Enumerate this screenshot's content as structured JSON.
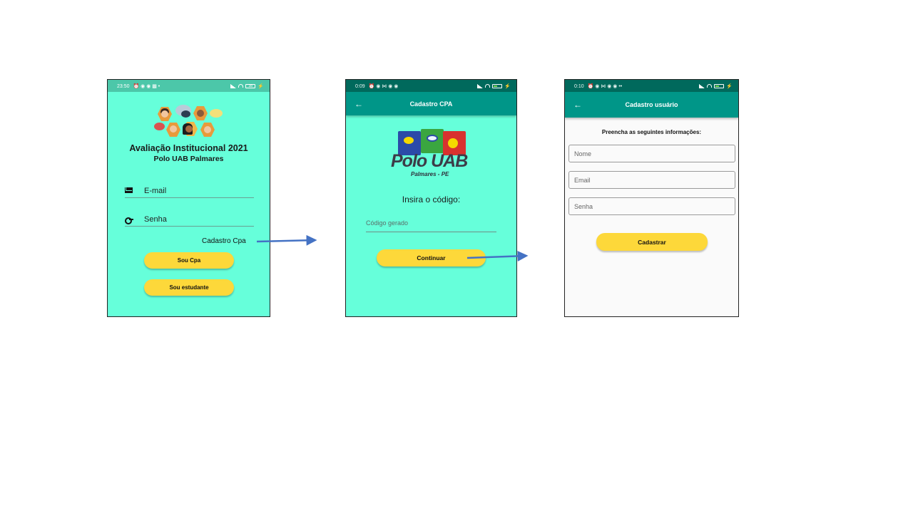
{
  "screen1": {
    "status": {
      "time": "23:50",
      "icons": "⏰ ◉ ◉ ▩ •",
      "battery": "38"
    },
    "title": "Avaliação Institucional 2021",
    "subtitle": "Polo UAB Palmares",
    "email_label": "E-mail",
    "password_label": "Senha",
    "cadastro_link": "Cadastro Cpa",
    "btn_cpa": "Sou Cpa",
    "btn_estudante": "Sou estudante"
  },
  "screen2": {
    "status": {
      "time": "0:09",
      "icons": "⏰ ◉ ⋈ ◉ ◉"
    },
    "appbar_title": "Cadastro CPA",
    "logo_text": "Polo UAB",
    "logo_sub": "Palmares - PE",
    "prompt": "Insira o código:",
    "code_placeholder": "Código gerado",
    "btn_continuar": "Continuar"
  },
  "screen3": {
    "status": {
      "time": "0:10",
      "icons": "⏰ ◉ ⋈ ◉ ◉ ••"
    },
    "appbar_title": "Cadastro usuário",
    "instructions": "Preencha as seguintes informações:",
    "field_nome": "Nome",
    "field_email": "Email",
    "field_senha": "Senha",
    "btn_cadastrar": "Cadastrar"
  },
  "colors": {
    "mint_background": "#66ffda",
    "appbar_teal": "#009688",
    "button_yellow": "#fdd83a",
    "arrow_blue": "#4472c4"
  }
}
